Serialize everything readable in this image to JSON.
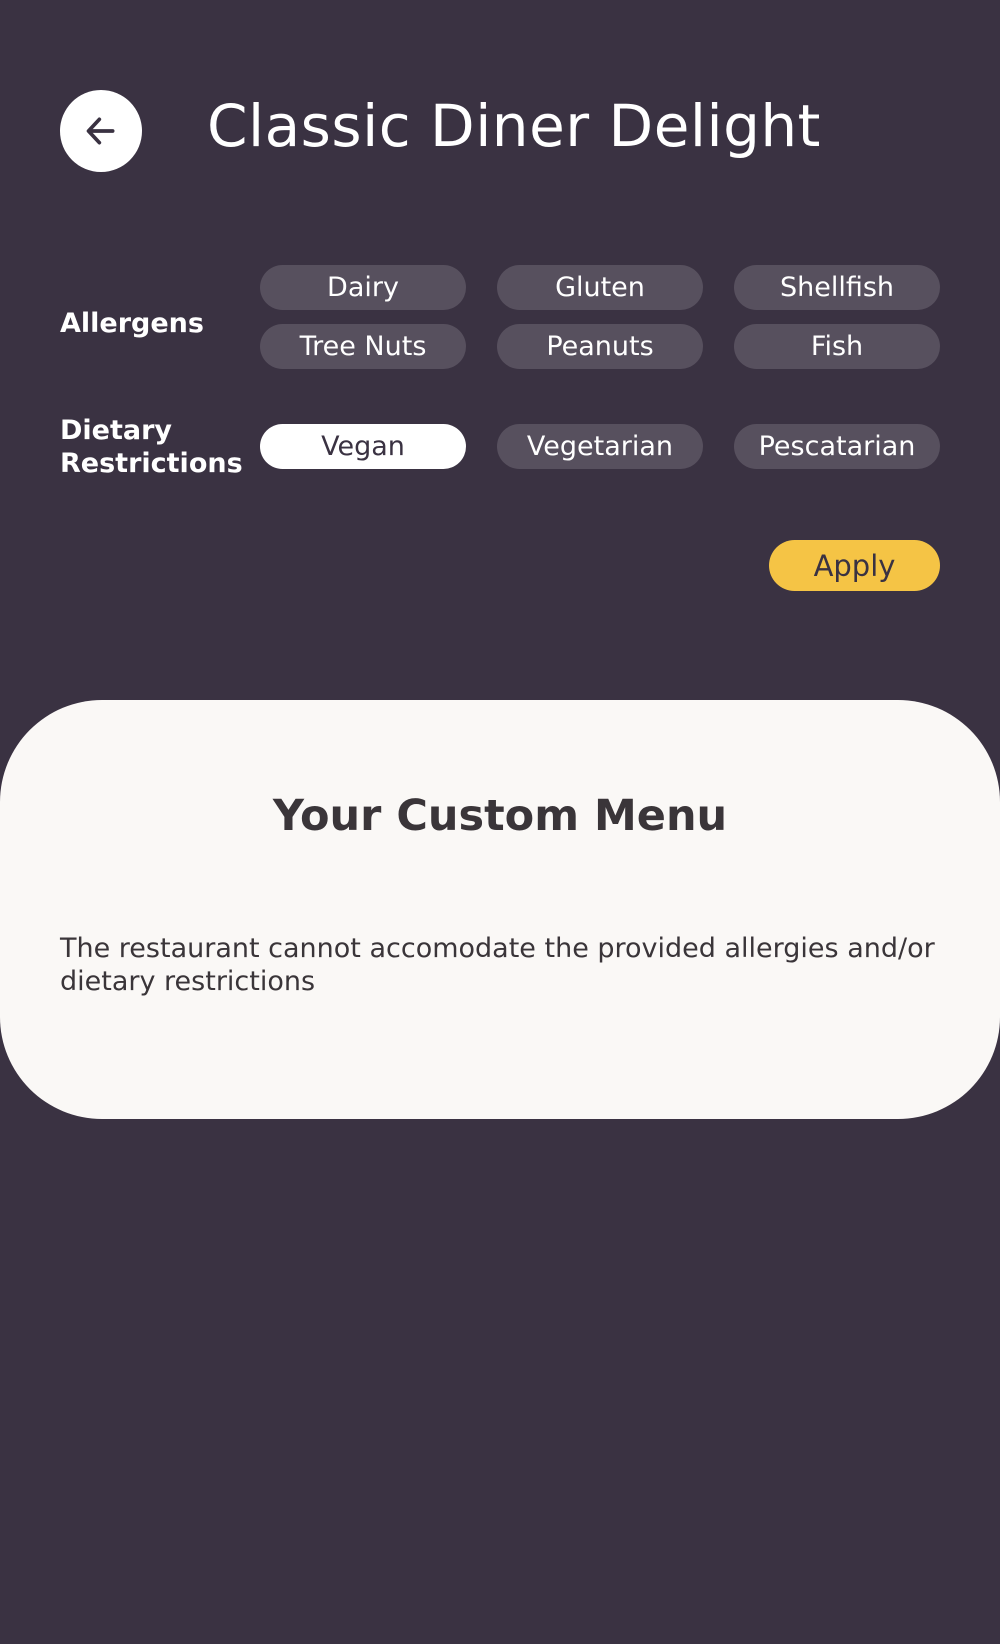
{
  "header": {
    "title": "Classic Diner Delight",
    "back_icon": "arrow-left-icon"
  },
  "filters": {
    "allergens_label": "Allergens",
    "allergens": [
      "Dairy",
      "Gluten",
      "Shellfish",
      "Tree Nuts",
      "Peanuts",
      "Fish"
    ],
    "dietary_label": "Dietary Restrictions",
    "dietary": [
      "Vegan",
      "Vegetarian",
      "Pescatarian"
    ],
    "selected_dietary": "Vegan",
    "apply_label": "Apply"
  },
  "menu": {
    "title": "Your Custom Menu",
    "message": "The restaurant cannot accomodate the provided allergies and/or dietary restrictions"
  },
  "colors": {
    "background": "#3a3242",
    "chip": "#57505e",
    "chip_selected": "#ffffff",
    "accent": "#f5c445",
    "card": "#faf8f6"
  }
}
